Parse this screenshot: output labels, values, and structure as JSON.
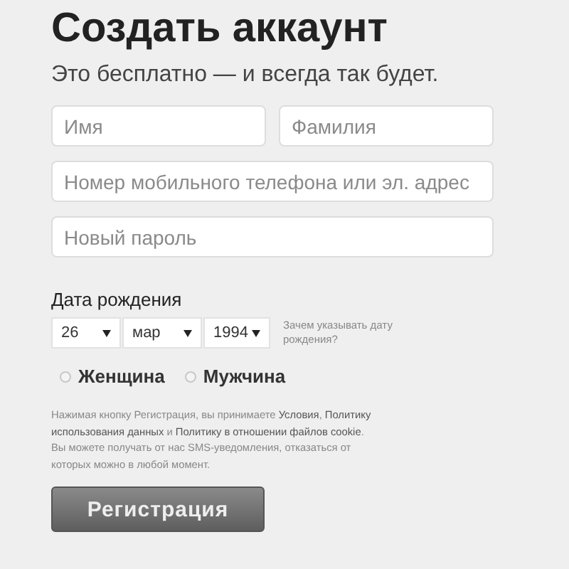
{
  "title": "Создать аккаунт",
  "subtitle": "Это бесплатно — и всегда так будет.",
  "fields": [
    {
      "placeholder": "Имя"
    },
    {
      "placeholder": "Фамилия"
    },
    {
      "placeholder": "Номер мобильного телефона или эл. адрес"
    },
    {
      "placeholder": "Новый пароль"
    }
  ],
  "birthday": {
    "label": "Дата рождения",
    "selects": [
      {
        "value": "26"
      },
      {
        "value": "мар"
      },
      {
        "value": "1994"
      }
    ],
    "hint": "Зачем указывать дату рождения?"
  },
  "gender": [
    {
      "label": "Женщина",
      "selected": false
    },
    {
      "label": "Мужчина",
      "selected": false
    }
  ],
  "terms": "Нажимая кнопку Регистрация, вы принимаете **Условия**, **Политику использования данных** и **Политику в отношении файлов cookie**. Вы можете получать от нас SMS-уведомления, отказаться от которых можно в любой момент.",
  "button": "Регистрация"
}
